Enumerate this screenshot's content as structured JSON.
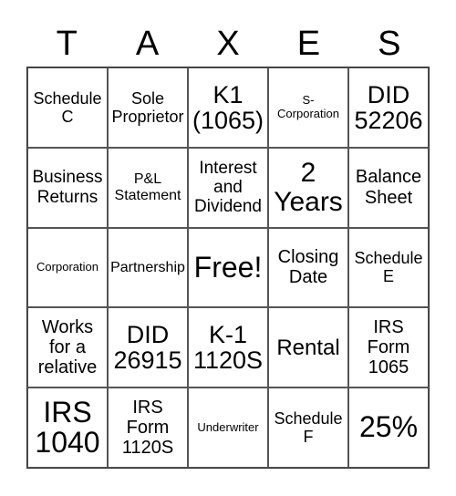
{
  "header": {
    "letters": [
      "T",
      "A",
      "X",
      "E",
      "S"
    ]
  },
  "board": {
    "cells": [
      [
        "Schedule C",
        "Sole Proprietor",
        "K1 (1065)",
        "S- Corporation",
        "DID 52206"
      ],
      [
        "Business Returns",
        "P&L Statement",
        "Interest and Dividend",
        "2 Years",
        "Balance Sheet"
      ],
      [
        "Corporation",
        "Partnership",
        "Free!",
        "Closing Date",
        "Schedule E"
      ],
      [
        "Works for a relative",
        "DID 26915",
        "K-1 1120S",
        "Rental",
        "IRS Form 1065"
      ],
      [
        "IRS 1040",
        "IRS Form 1120S",
        "Underwriter",
        "Schedule F",
        "25%"
      ]
    ]
  }
}
